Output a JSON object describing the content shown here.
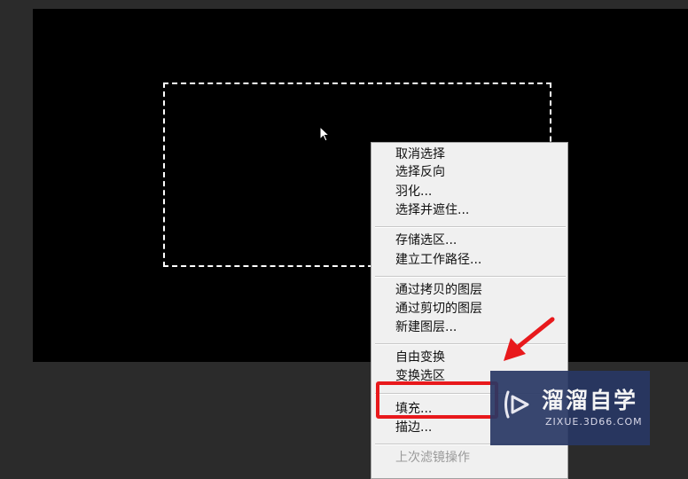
{
  "context_menu": {
    "items": [
      {
        "label": "取消选择"
      },
      {
        "label": "选择反向"
      },
      {
        "label": "羽化..."
      },
      {
        "label": "选择并遮住..."
      },
      {
        "label": "存储选区..."
      },
      {
        "label": "建立工作路径..."
      },
      {
        "label": "通过拷贝的图层"
      },
      {
        "label": "通过剪切的图层"
      },
      {
        "label": "新建图层..."
      },
      {
        "label": "自由变换"
      },
      {
        "label": "变换选区"
      },
      {
        "label": "填充..."
      },
      {
        "label": "描边..."
      },
      {
        "label": "上次滤镜操作"
      }
    ]
  },
  "annotation": {
    "highlight_color": "#e8191c",
    "highlighted_item": "填充..."
  },
  "watermark": {
    "title": "溜溜自学",
    "subtitle": "ZIXUE.3D66.COM",
    "logo_icon": "play-logo-icon"
  },
  "colors": {
    "workspace": "#2b2b2b",
    "canvas": "#000000",
    "menu_bg": "#f0f0f0",
    "watermark_bg": "#283764"
  }
}
